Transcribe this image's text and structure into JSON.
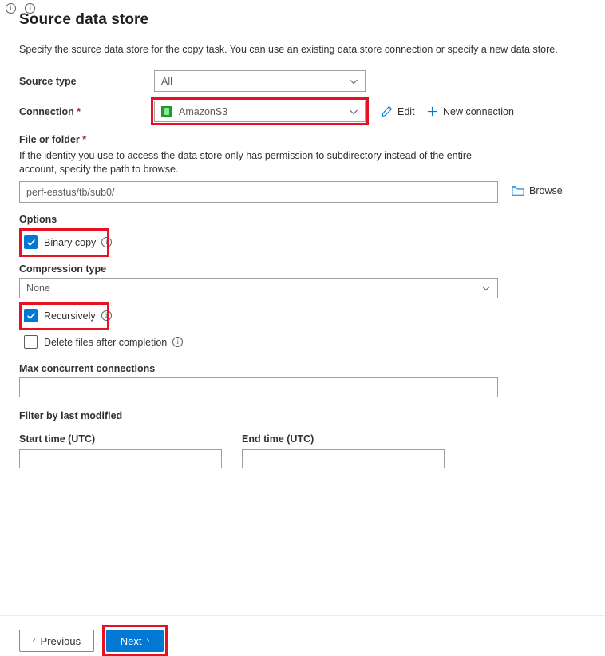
{
  "page": {
    "title": "Source data store",
    "description": "Specify the source data store for the copy task. You can use an existing data store connection or specify a new data store."
  },
  "source_type": {
    "label": "Source type",
    "value": "All",
    "chevron_icon": "chevron-down-icon"
  },
  "connection": {
    "label": "Connection",
    "required_marker": "*",
    "value": "AmazonS3",
    "icon": "amazon-s3-icon",
    "chevron_icon": "chevron-down-icon",
    "edit_label": "Edit",
    "edit_icon": "pencil-icon",
    "new_connection_label": "New connection",
    "new_connection_icon": "plus-icon"
  },
  "file_or_folder": {
    "label": "File or folder",
    "required_marker": "*",
    "help": "If the identity you use to access the data store only has permission to subdirectory instead of the entire account, specify the path to browse.",
    "value": "perf-eastus/tb/sub0/",
    "placeholder": "",
    "browse_label": "Browse",
    "browse_icon": "folder-icon"
  },
  "options": {
    "label": "Options",
    "binary_copy": {
      "label": "Binary copy",
      "checked": true,
      "info_icon": "info-icon"
    },
    "compression_type": {
      "label": "Compression type",
      "value": "None",
      "chevron_icon": "chevron-down-icon"
    },
    "recursively": {
      "label": "Recursively",
      "checked": true,
      "info_icon": "info-icon"
    },
    "delete_files": {
      "label": "Delete files after completion",
      "checked": false,
      "info_icon": "info-icon"
    },
    "max_concurrent_connections": {
      "label": "Max concurrent connections",
      "value": "",
      "placeholder": "",
      "info_icon": "info-icon"
    }
  },
  "filter": {
    "label": "Filter by last modified",
    "start_time_label": "Start time (UTC)",
    "start_time_value": "",
    "end_time_label": "End time (UTC)",
    "end_time_value": "",
    "info_icon": "info-icon"
  },
  "footer": {
    "previous_label": "Previous",
    "previous_arrow": "‹",
    "next_label": "Next",
    "next_arrow": "›"
  },
  "annotations": {
    "highlight_color": "#e81123",
    "accent_color": "#0078d4",
    "required_color": "#a4262c",
    "boxes": [
      "connection-dropdown",
      "binary-copy-checkbox",
      "recursively-checkbox",
      "next-button"
    ]
  }
}
